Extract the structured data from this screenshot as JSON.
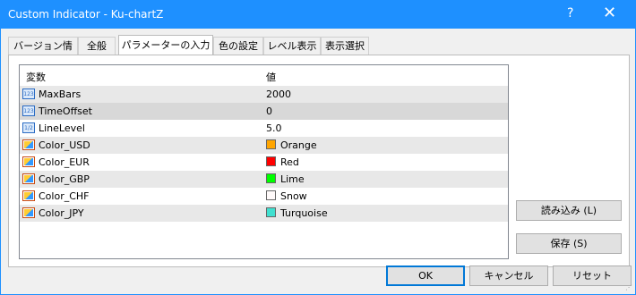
{
  "window": {
    "title": "Custom Indicator - Ku-chartZ",
    "help_glyph": "?",
    "close_glyph": "✕"
  },
  "tabs": [
    {
      "label": "バージョン情報"
    },
    {
      "label": "全般"
    },
    {
      "label": "パラメーターの入力"
    },
    {
      "label": "色の設定"
    },
    {
      "label": "レベル表示"
    },
    {
      "label": "表示選択"
    }
  ],
  "grid": {
    "headers": {
      "name": "変数",
      "value": "値"
    },
    "rows": [
      {
        "name": "MaxBars",
        "value": "2000",
        "icon": "integer-icon",
        "icon_text": "123"
      },
      {
        "name": "TimeOffset",
        "value": "0",
        "icon": "integer-icon",
        "icon_text": "123"
      },
      {
        "name": "LineLevel",
        "value": "5.0",
        "icon": "double-icon",
        "icon_text": "1/2"
      },
      {
        "name": "Color_USD",
        "value": "Orange",
        "icon": "color-icon",
        "swatch": "#ffa500"
      },
      {
        "name": "Color_EUR",
        "value": "Red",
        "icon": "color-icon",
        "swatch": "#ff0000"
      },
      {
        "name": "Color_GBP",
        "value": "Lime",
        "icon": "color-icon",
        "swatch": "#00ff00"
      },
      {
        "name": "Color_CHF",
        "value": "Snow",
        "icon": "color-icon",
        "swatch": "#fffafa"
      },
      {
        "name": "Color_JPY",
        "value": "Turquoise",
        "icon": "color-icon",
        "swatch": "#40e0d0"
      }
    ]
  },
  "buttons": {
    "load": "読み込み (L)",
    "save": "保存 (S)",
    "ok": "OK",
    "cancel": "キャンセル",
    "reset": "リセット"
  },
  "colors": {
    "title_bar": "#1e90ff",
    "accent": "#0078d7"
  }
}
